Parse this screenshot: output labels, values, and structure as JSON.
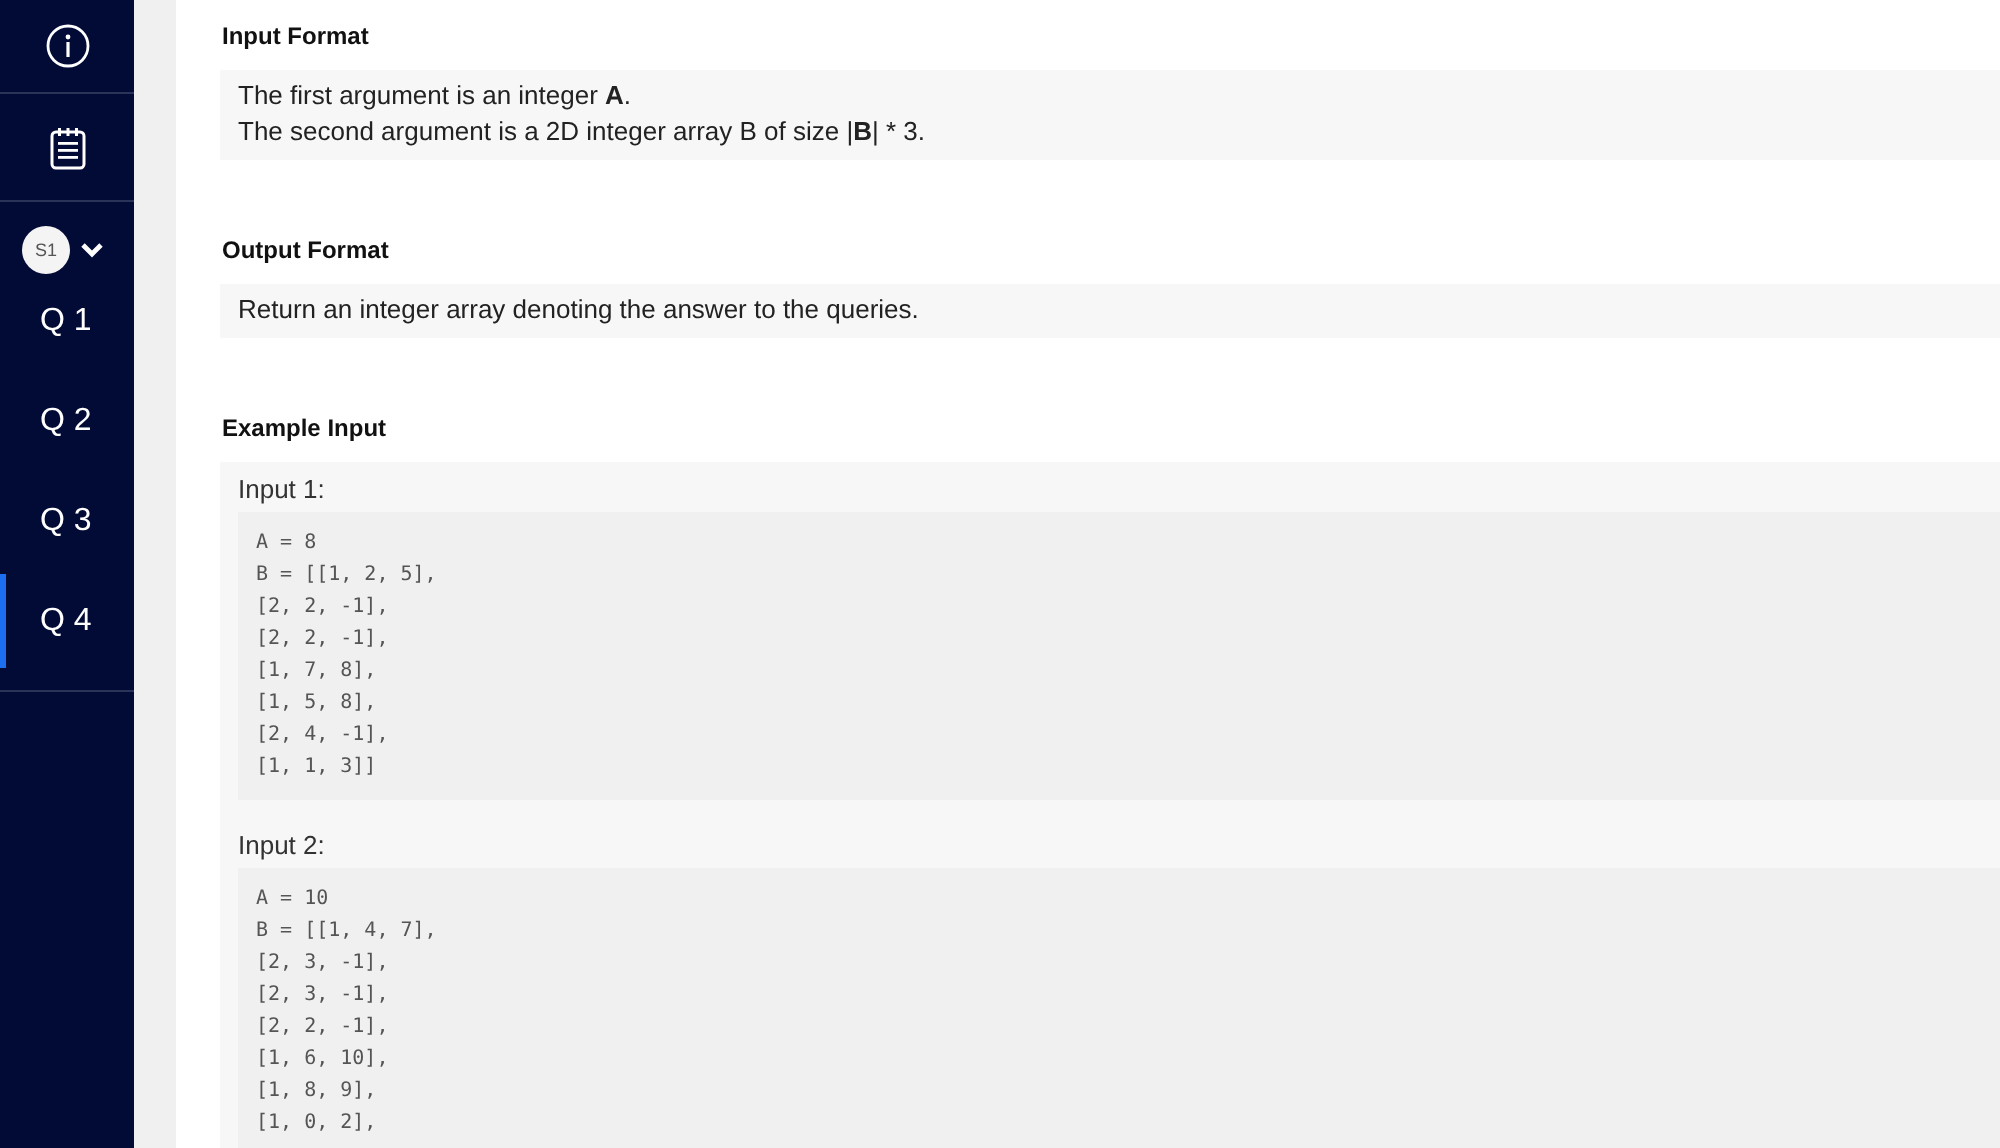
{
  "sidebar": {
    "badge": "S1",
    "questions": [
      {
        "label": "Q 1",
        "selected": false
      },
      {
        "label": "Q 2",
        "selected": false
      },
      {
        "label": "Q 3",
        "selected": false
      },
      {
        "label": "Q 4",
        "selected": true
      }
    ]
  },
  "sections": [
    {
      "kind": "text",
      "heading": "Input Format",
      "lines": [
        "The first argument is an integer **A**.",
        "The second argument is a 2D integer array B of size |**B**| * 3."
      ]
    },
    {
      "kind": "text",
      "heading": "Output Format",
      "lines": [
        "Return an integer array denoting the answer to the queries."
      ]
    },
    {
      "kind": "examples",
      "heading": "Example Input",
      "examples": [
        {
          "label": "Input 1:",
          "code": [
            "A = 8",
            "B = [[1, 2, 5],",
            "[2, 2, -1],",
            "[2, 2, -1],",
            "[1, 7, 8],",
            "[1, 5, 8],",
            "[2, 4, -1],",
            "[1, 1, 3]]"
          ]
        },
        {
          "label": "Input 2:",
          "code": [
            "A = 10",
            "B = [[1, 4, 7],",
            "[2, 3, -1],",
            "[2, 3, -1],",
            "[2, 2, -1],",
            "[1, 6, 10],",
            "[1, 8, 9],",
            "[1, 0, 2],"
          ]
        }
      ]
    }
  ]
}
